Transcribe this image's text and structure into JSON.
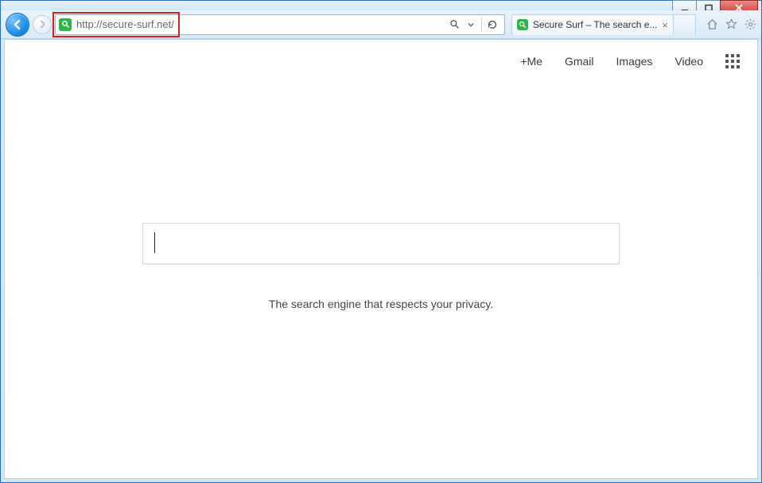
{
  "window": {
    "minimize_label": "Minimize",
    "maximize_label": "Maximize",
    "close_label": "Close"
  },
  "toolbar": {
    "url": "http://secure-surf.net/",
    "site_icon_name": "magnifier-icon",
    "highlight": true
  },
  "tab": {
    "title": "Secure Surf – The search e...",
    "icon_name": "magnifier-icon"
  },
  "page": {
    "links": {
      "me": "+Me",
      "gmail": "Gmail",
      "images": "Images",
      "video": "Video"
    },
    "search_value": "",
    "search_placeholder": "",
    "tagline": "The search engine that respects your privacy."
  }
}
